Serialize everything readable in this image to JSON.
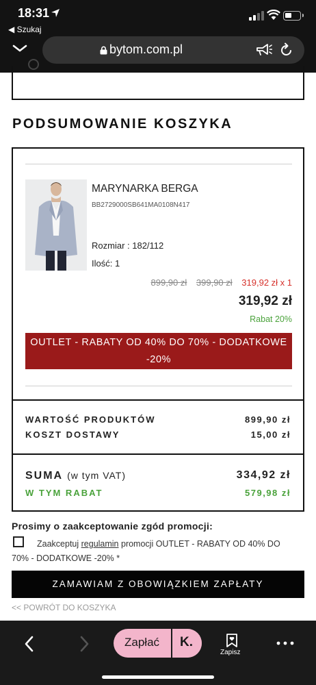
{
  "status_bar": {
    "time": "18:31",
    "back_app": "◀ Szukaj"
  },
  "browser": {
    "url": "bytom.com.pl"
  },
  "page": {
    "section_title": "PODSUMOWANIE KOSZYKA",
    "product": {
      "name": "MARYNARKA BERGA",
      "sku": "BB2729000SB641MA0108N417",
      "size": "Rozmiar : 182/112",
      "quantity": "Ilość: 1",
      "old_price_1": "899,90 zł",
      "old_price_2": "399,90 zł",
      "current_price_qty": "319,92 zł x 1",
      "total_price": "319,92 zł",
      "discount": "Rabat 20%",
      "promo_banner": "OUTLET - RABATY OD 40% DO 70% - DODATKOWE -20%"
    },
    "summary": {
      "products_label": "WARTOŚĆ PRODUKTÓW",
      "products_value": "899,90 zł",
      "shipping_label": "KOSZT DOSTAWY",
      "shipping_value": "15,00 zł",
      "total_label": "SUMA",
      "total_vat": "(w tym VAT)",
      "total_value": "334,92 zł",
      "discount_label": "W TYM RABAT",
      "discount_value": "579,98 zł"
    },
    "consent": {
      "title": "Prosimy o zaakceptowanie zgód promocji:",
      "text_before": "Zaakceptuj ",
      "link": "regulamin",
      "text_after": " promocji OUTLET - RABATY OD 40% DO 70% - DODATKOWE -20% *",
      "checked": false
    },
    "order_button": "ZAMAWIAM Z OBOWIĄZKIEM ZAPŁATY",
    "back_link": "<< POWRÓT DO KOSZYKA"
  },
  "toolbar": {
    "pay_label": "Zapłać",
    "klarna_label": "K.",
    "save_label": "Zapisz"
  },
  "colors": {
    "promo_red": "#9a1a1a",
    "price_red": "#d6312b",
    "discount_green": "#4aa23b",
    "klarna_pink": "#f3b5cb"
  }
}
